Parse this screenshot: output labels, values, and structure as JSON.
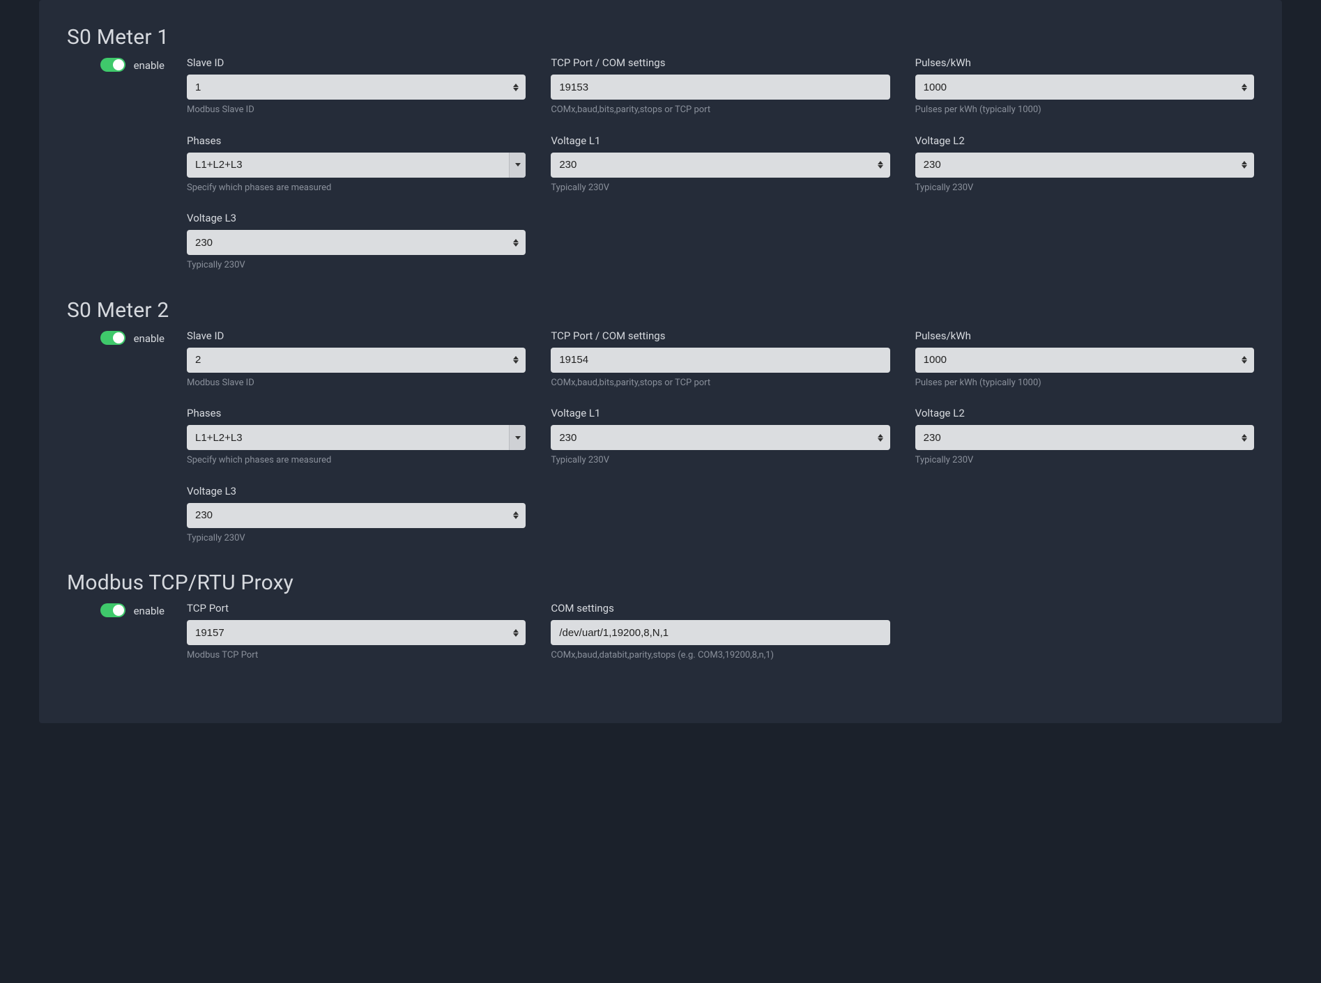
{
  "sections": [
    {
      "title": "S0 Meter 1",
      "enable_label": "enable",
      "enable_on": true,
      "fields": [
        {
          "key": "slave_id",
          "label": "Slave ID",
          "type": "number",
          "value": "1",
          "help": "Modbus Slave ID"
        },
        {
          "key": "tcp_com",
          "label": "TCP Port / COM settings",
          "type": "text",
          "value": "19153",
          "help": "COMx,baud,bits,parity,stops or TCP port"
        },
        {
          "key": "pulses",
          "label": "Pulses/kWh",
          "type": "number",
          "value": "1000",
          "help": "Pulses per kWh (typically 1000)"
        },
        {
          "key": "phases",
          "label": "Phases",
          "type": "select",
          "value": "L1+L2+L3",
          "help": "Specify which phases are measured"
        },
        {
          "key": "vl1",
          "label": "Voltage L1",
          "type": "number",
          "value": "230",
          "help": "Typically 230V"
        },
        {
          "key": "vl2",
          "label": "Voltage L2",
          "type": "number",
          "value": "230",
          "help": "Typically 230V"
        },
        {
          "key": "vl3",
          "label": "Voltage L3",
          "type": "number",
          "value": "230",
          "help": "Typically 230V"
        }
      ]
    },
    {
      "title": "S0 Meter 2",
      "enable_label": "enable",
      "enable_on": true,
      "fields": [
        {
          "key": "slave_id",
          "label": "Slave ID",
          "type": "number",
          "value": "2",
          "help": "Modbus Slave ID"
        },
        {
          "key": "tcp_com",
          "label": "TCP Port / COM settings",
          "type": "text",
          "value": "19154",
          "help": "COMx,baud,bits,parity,stops or TCP port"
        },
        {
          "key": "pulses",
          "label": "Pulses/kWh",
          "type": "number",
          "value": "1000",
          "help": "Pulses per kWh (typically 1000)"
        },
        {
          "key": "phases",
          "label": "Phases",
          "type": "select",
          "value": "L1+L2+L3",
          "help": "Specify which phases are measured"
        },
        {
          "key": "vl1",
          "label": "Voltage L1",
          "type": "number",
          "value": "230",
          "help": "Typically 230V"
        },
        {
          "key": "vl2",
          "label": "Voltage L2",
          "type": "number",
          "value": "230",
          "help": "Typically 230V"
        },
        {
          "key": "vl3",
          "label": "Voltage L3",
          "type": "number",
          "value": "230",
          "help": "Typically 230V"
        }
      ]
    },
    {
      "title": "Modbus TCP/RTU Proxy",
      "enable_label": "enable",
      "enable_on": true,
      "fields": [
        {
          "key": "tcp_port",
          "label": "TCP Port",
          "type": "number",
          "value": "19157",
          "help": "Modbus TCP Port"
        },
        {
          "key": "com",
          "label": "COM settings",
          "type": "text",
          "value": "/dev/uart/1,19200,8,N,1",
          "help": "COMx,baud,databit,parity,stops (e.g. COM3,19200,8,n,1)"
        }
      ]
    }
  ]
}
